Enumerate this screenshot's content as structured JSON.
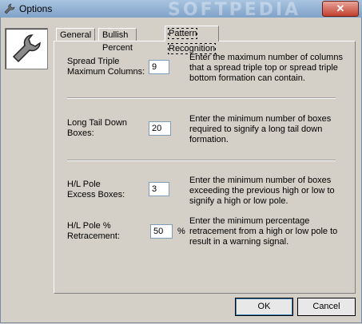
{
  "window": {
    "title": "Options",
    "watermark": "SOFTPEDIA"
  },
  "tabs": [
    {
      "label": "General"
    },
    {
      "label": "Bullish Percent"
    },
    {
      "label": "Pattern Recognition"
    }
  ],
  "fields": {
    "spread_triple": {
      "label_line1": "Spread Triple",
      "label_line2": "Maximum Columns:",
      "value": "9",
      "desc": [
        "Enter the maximum number of columns",
        "that a spread triple top or spread triple",
        "bottom formation can contain."
      ]
    },
    "long_tail": {
      "label_line1": "Long Tail Down",
      "label_line2": "Boxes:",
      "value": "20",
      "desc": [
        "Enter the minimum number of boxes",
        "required to signify a long tail down",
        "formation."
      ]
    },
    "hl_pole_excess": {
      "label_line1": "H/L Pole",
      "label_line2": "Excess Boxes:",
      "value": "3",
      "desc": [
        "Enter the minimum number of boxes",
        "exceeding the previous high or low to",
        "signify a high or low pole."
      ]
    },
    "hl_pole_retrace": {
      "label_line1": "H/L Pole %",
      "label_line2": "Retracement:",
      "value": "50",
      "unit": "%",
      "desc": [
        "Enter the minimum percentage",
        "retracement from a high or low pole to",
        "result in a warning signal."
      ]
    }
  },
  "buttons": {
    "ok": "OK",
    "cancel": "Cancel"
  }
}
